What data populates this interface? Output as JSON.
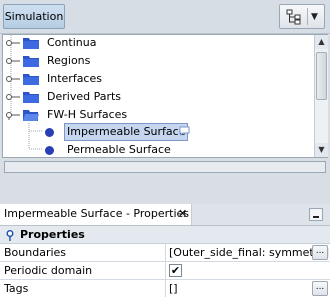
{
  "toolbar": {
    "simulation_label": "Simulation",
    "tree_icon": "tree-hierarchy-icon"
  },
  "tree": {
    "items": [
      {
        "label": "Continua",
        "icon": "folder-icon"
      },
      {
        "label": "Regions",
        "icon": "folder-icon"
      },
      {
        "label": "Interfaces",
        "icon": "folder-icon"
      },
      {
        "label": "Derived Parts",
        "icon": "folder-icon"
      },
      {
        "label": "FW-H Surfaces",
        "icon": "folder-open-icon"
      }
    ],
    "children": [
      {
        "label": "Impermeable Surface",
        "selected": true
      },
      {
        "label": "Permeable Surface",
        "selected": false
      }
    ]
  },
  "properties_panel": {
    "tab_title": "Impermeable Surface - Properties",
    "close_label": "✕",
    "section_label": "Properties",
    "rows": [
      {
        "name": "Boundaries",
        "value": "[Outer_side_final: symmetry]",
        "button": "..."
      },
      {
        "name": "Periodic domain",
        "checked": true,
        "check_glyph": "✔"
      },
      {
        "name": "Tags",
        "value": "[]",
        "button": "..."
      }
    ]
  },
  "colors": {
    "accent_selection": "#c5d6ee",
    "node_dot": "#2a3fb3",
    "folder": "#2d55c8"
  }
}
